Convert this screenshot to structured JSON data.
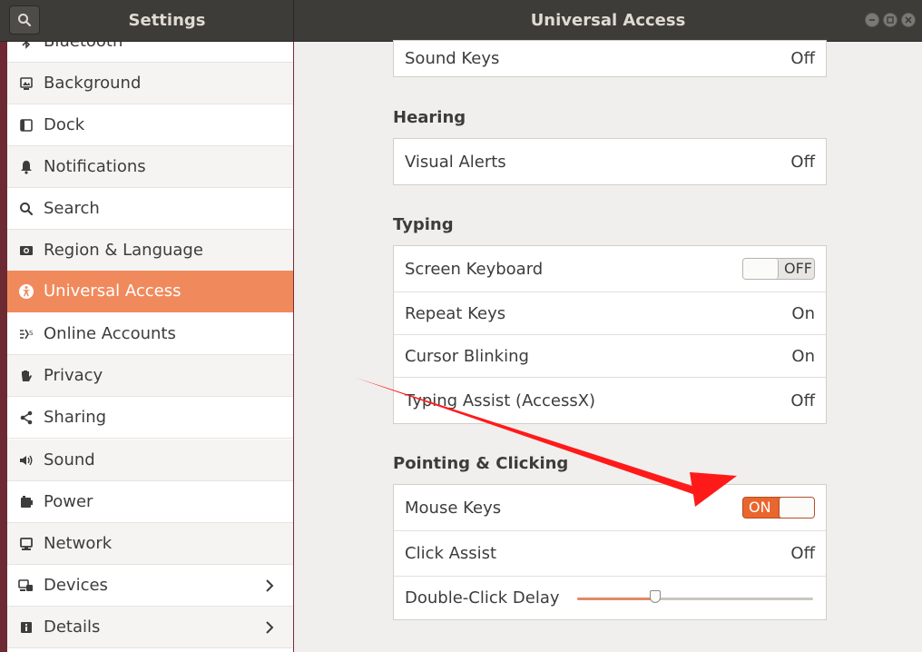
{
  "header": {
    "left_title": "Settings",
    "right_title": "Universal Access"
  },
  "sidebar": {
    "partial_item": "Bluetooth",
    "items": [
      {
        "label": "Background",
        "icon": "background-icon"
      },
      {
        "label": "Dock",
        "icon": "dock-icon"
      },
      {
        "label": "Notifications",
        "icon": "bell-icon"
      },
      {
        "label": "Search",
        "icon": "search-icon"
      },
      {
        "label": "Region & Language",
        "icon": "region-icon"
      },
      {
        "label": "Universal Access",
        "icon": "accessibility-icon",
        "active": true
      },
      {
        "label": "Online Accounts",
        "icon": "online-accounts-icon"
      },
      {
        "label": "Privacy",
        "icon": "hand-icon"
      },
      {
        "label": "Sharing",
        "icon": "share-icon"
      },
      {
        "label": "Sound",
        "icon": "speaker-icon"
      },
      {
        "label": "Power",
        "icon": "battery-icon"
      },
      {
        "label": "Network",
        "icon": "network-icon"
      },
      {
        "label": "Devices",
        "icon": "devices-icon",
        "chevron": true
      },
      {
        "label": "Details",
        "icon": "info-icon",
        "chevron": true
      }
    ]
  },
  "main": {
    "top_row": {
      "label": "Sound Keys",
      "value": "Off"
    },
    "hearing": {
      "title": "Hearing",
      "rows": [
        {
          "label": "Visual Alerts",
          "value": "Off"
        }
      ]
    },
    "typing": {
      "title": "Typing",
      "rows": [
        {
          "label": "Screen Keyboard",
          "toggle": "OFF"
        },
        {
          "label": "Repeat Keys",
          "value": "On"
        },
        {
          "label": "Cursor Blinking",
          "value": "On"
        },
        {
          "label": "Typing Assist (AccessX)",
          "value": "Off"
        }
      ]
    },
    "pointing": {
      "title": "Pointing & Clicking",
      "rows": [
        {
          "label": "Mouse Keys",
          "toggle": "ON"
        },
        {
          "label": "Click Assist",
          "value": "Off"
        },
        {
          "label": "Double-Click Delay",
          "slider_fraction": 0.33
        }
      ]
    }
  },
  "colors": {
    "accent": "#f08a5c",
    "toggle_on": "#e9662e",
    "header_bg": "#3d3c38",
    "annotation_arrow": "#ff1a1a"
  }
}
